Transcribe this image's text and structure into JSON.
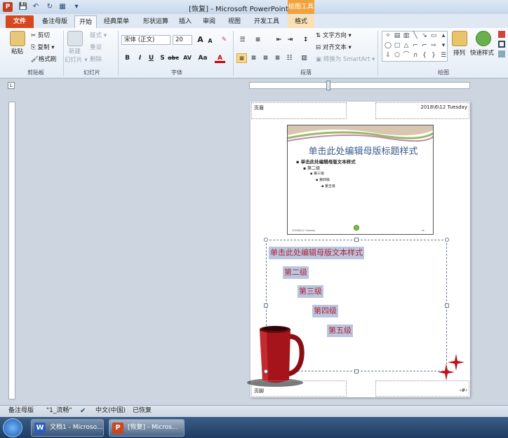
{
  "window": {
    "app_icon": "P",
    "title": "[恢复] - Microsoft PowerPoint",
    "context_tab_group": "绘图工具"
  },
  "qat": {
    "save": "💾",
    "undo": "↶",
    "redo": "↻",
    "layout": "▦",
    "more": "▾"
  },
  "tabs": [
    {
      "label": "文件"
    },
    {
      "label": "备注母版"
    },
    {
      "label": "开始"
    },
    {
      "label": "经典菜单"
    },
    {
      "label": "形状运算"
    },
    {
      "label": "插入"
    },
    {
      "label": "审阅"
    },
    {
      "label": "视图"
    },
    {
      "label": "开发工具"
    },
    {
      "label": "格式"
    }
  ],
  "ribbon": {
    "clipboard": {
      "paste": "粘贴",
      "cut": "剪切",
      "copy": "复制 ▾",
      "format_painter": "格式刷",
      "label": "剪贴板"
    },
    "slides": {
      "new_slide": "新建",
      "new_slide2": "幻灯片 ▾",
      "layout": "版式 ▾",
      "reset": "重设",
      "delete": "删除",
      "label": "幻灯片"
    },
    "font": {
      "font_name": "宋体 (正文)",
      "font_size": "20",
      "grow": "A",
      "shrink": "A",
      "clear": "✎",
      "bold": "B",
      "italic": "I",
      "underline": "U",
      "shadow": "S",
      "strike": "abc",
      "spacing": "AV",
      "case": "Aa",
      "color": "A",
      "label": "字体"
    },
    "paragraph": {
      "text_direction": "文字方向 ▾",
      "align_text": "对齐文本 ▾",
      "smartart": "转换为 SmartArt ▾",
      "label": "段落"
    },
    "drawing": {
      "arrange": "排列",
      "quick_styles": "快速样式",
      "label": "绘图"
    }
  },
  "page": {
    "header_left": "页眉",
    "header_right": "2018\\6\\12 Tuesday",
    "footer_left": "页脚",
    "footer_right": "‹#›"
  },
  "slide": {
    "title": "单击此处编辑母版标题样式",
    "levels": [
      "单击此处编辑母版文本样式",
      "第二级",
      "第三级",
      "第四级",
      "第五级"
    ],
    "footer_left": "2018\\6\\12 Tuesday",
    "footer_right": "‹#›"
  },
  "notes": {
    "levels": [
      "单击此处编辑母版文本样式",
      "第二级",
      "第三级",
      "第四级",
      "第五级"
    ]
  },
  "statusbar": {
    "view": "备注母版",
    "theme": "\"1_流畅\"",
    "language": "中文(中国)",
    "recovered": "已恢复"
  },
  "taskbar": {
    "items": [
      {
        "label": "文档1 - Microso..."
      },
      {
        "label": "[恢复] - Micros..."
      }
    ]
  },
  "colors": {
    "accent_red": "#b3203c",
    "file_tab": "#d7471e",
    "context_orange": "#f2a23c"
  }
}
